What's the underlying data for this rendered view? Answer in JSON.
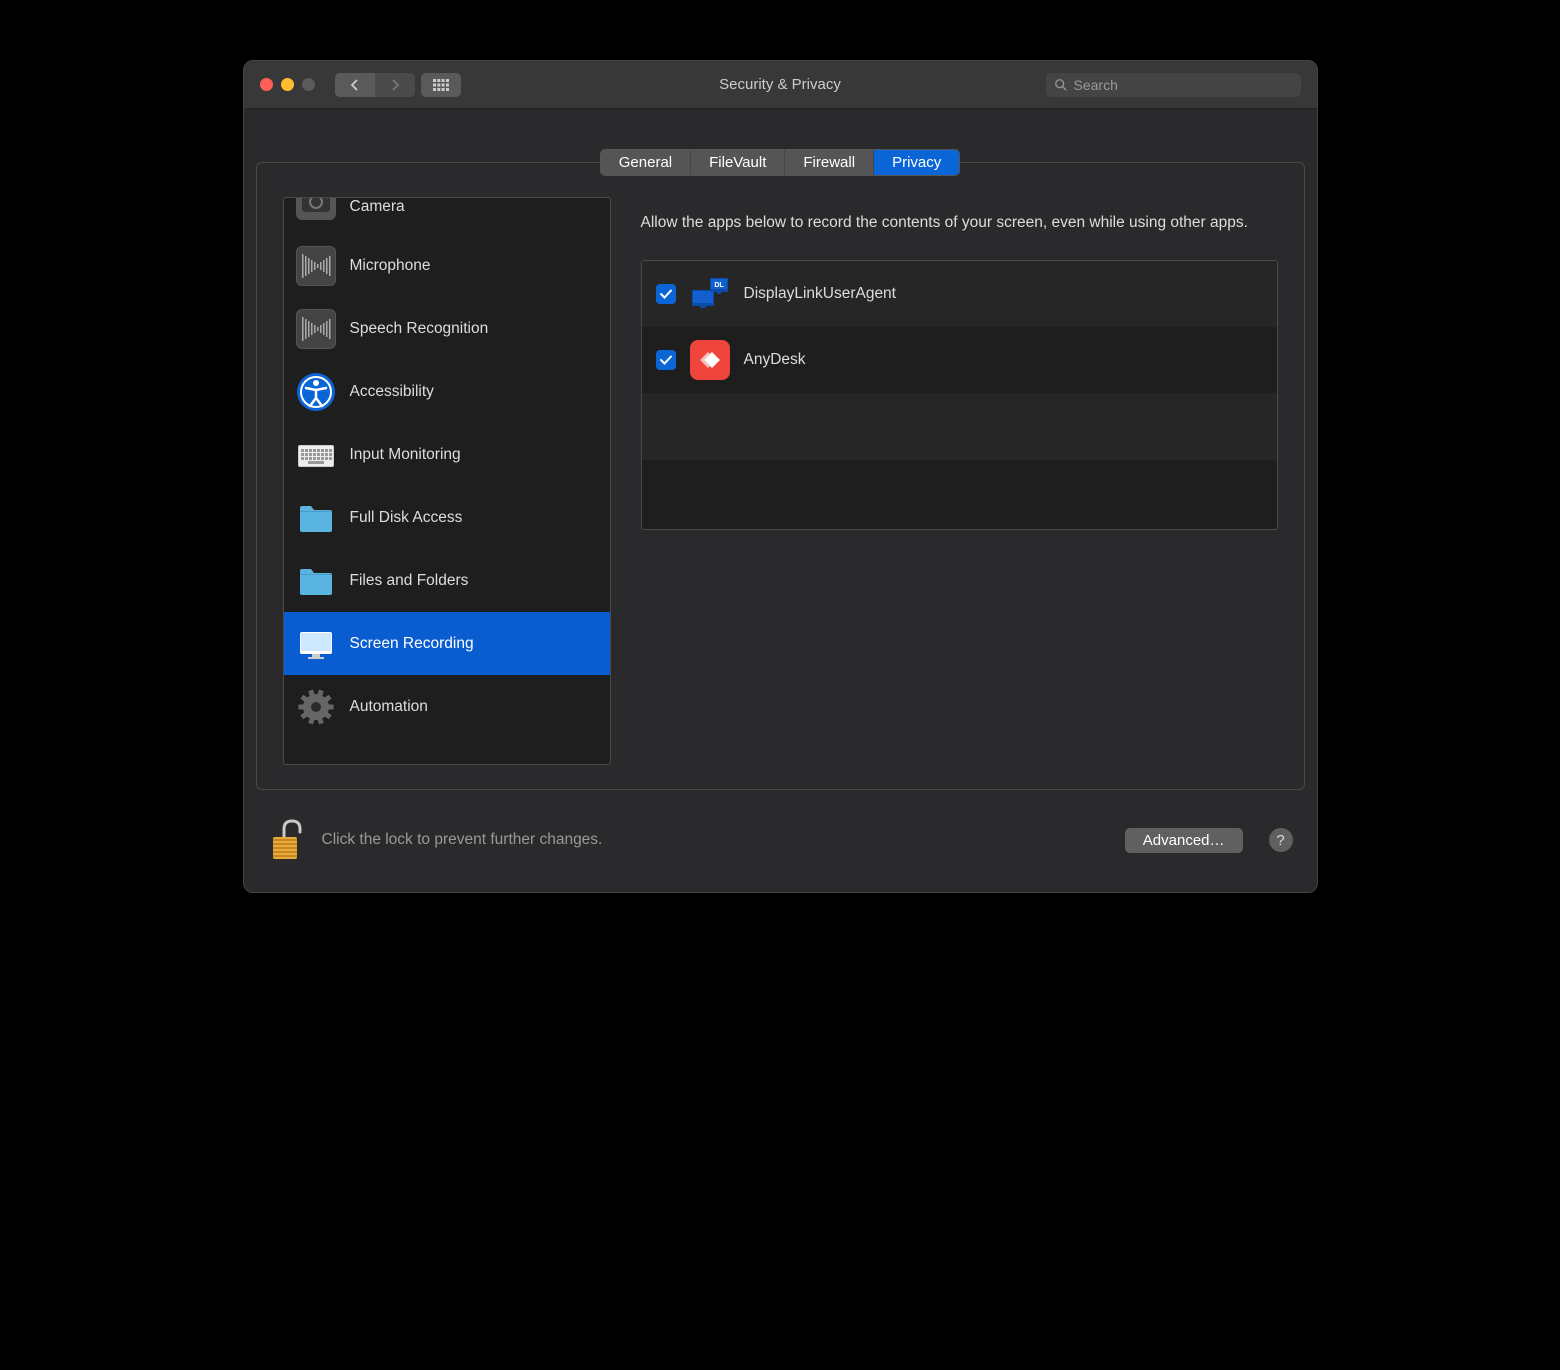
{
  "window": {
    "title": "Security & Privacy",
    "search_placeholder": "Search"
  },
  "tabs": [
    {
      "label": "General",
      "active": false
    },
    {
      "label": "FileVault",
      "active": false
    },
    {
      "label": "Firewall",
      "active": false
    },
    {
      "label": "Privacy",
      "active": true
    }
  ],
  "sidebar": {
    "items": [
      {
        "label": "Camera",
        "icon": "camera-icon",
        "selected": false,
        "partial": "top"
      },
      {
        "label": "Microphone",
        "icon": "microphone-icon",
        "selected": false
      },
      {
        "label": "Speech Recognition",
        "icon": "speech-icon",
        "selected": false
      },
      {
        "label": "Accessibility",
        "icon": "accessibility-icon",
        "selected": false
      },
      {
        "label": "Input Monitoring",
        "icon": "keyboard-icon",
        "selected": false
      },
      {
        "label": "Full Disk Access",
        "icon": "folder-icon",
        "selected": false
      },
      {
        "label": "Files and Folders",
        "icon": "folder-icon",
        "selected": false
      },
      {
        "label": "Screen Recording",
        "icon": "monitor-icon",
        "selected": true
      },
      {
        "label": "Automation",
        "icon": "gear-icon",
        "selected": false
      }
    ]
  },
  "content": {
    "description": "Allow the apps below to record the contents of your screen, even while using other apps.",
    "apps": [
      {
        "name": "DisplayLinkUserAgent",
        "checked": true,
        "icon": "displaylink-icon"
      },
      {
        "name": "AnyDesk",
        "checked": true,
        "icon": "anydesk-icon"
      }
    ]
  },
  "footer": {
    "lock_text": "Click the lock to prevent further changes.",
    "advanced_label": "Advanced…",
    "help_label": "?"
  }
}
